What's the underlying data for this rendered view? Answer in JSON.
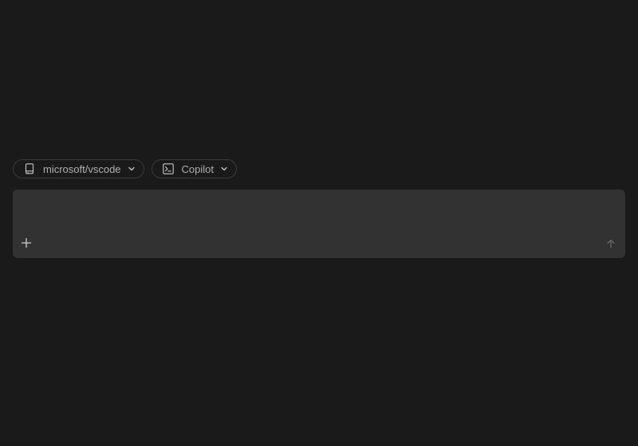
{
  "pills": {
    "repo": {
      "label": "microsoft/vscode",
      "icon": "repo-icon"
    },
    "agent": {
      "label": "Copilot",
      "icon": "terminal-icon"
    }
  },
  "composer": {
    "value": "",
    "placeholder": "",
    "add_icon": "plus-icon",
    "send_icon": "arrow-up-icon"
  },
  "colors": {
    "background": "#1a1a1a",
    "composer_background": "#323232",
    "pill_border": "#3b3b3b",
    "text": "#b0b0b0"
  }
}
